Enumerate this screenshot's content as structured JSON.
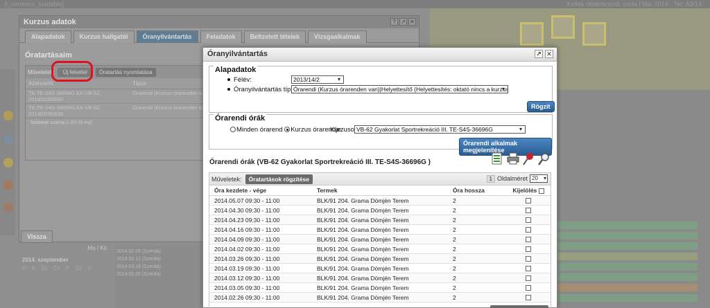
{
  "background": {
    "top_bar_left": "[t_common_loadable]",
    "top_bar_right": "Kellék oktatókoordi. iroda | Ma: 2014 · Ter: A3/14"
  },
  "course_window": {
    "title": "Kurzus adatok",
    "tabs": [
      "Alapadatok",
      "Kurzus hallgatói",
      "Óranyilvántartás",
      "Feladatok",
      "Befizetett tételek",
      "Vizsgaalkalmak"
    ],
    "active_tab": 2,
    "heading": "Óratartásaim",
    "ops_label": "Műveletek:",
    "new_button": "Új felvétel",
    "print_button": "Óratartás nyomtatása",
    "columns": [
      "Azonosító",
      "Típus"
    ],
    "rows": [
      {
        "id": "TK:TE-S4S-36696G;KK:VB-62; 201402050930",
        "type": "Órarendi (Kurzus órarenden van)"
      },
      {
        "id": "TK:TE-S4S-36696G;KK:VB-62; 201402050930",
        "type": "Órarendi (Kurzus órarenden van)"
      }
    ],
    "footer": "Találatok száma:1-2/2 (0 ms)",
    "back_button": "Vissza"
  },
  "calendar": {
    "nav": "Ma / Kö",
    "month": "2014. szeptember",
    "weekdays": "H K Sz Cs P Sz V",
    "list": [
      "2014.02.05 (Szerda)",
      "2014.02.12 (Szerda)",
      "2014.02.19 (Szerda)",
      "2014.02.26 (Szerda)"
    ]
  },
  "modal": {
    "title": "Óranyilvántartás",
    "basic_legend": "Alapadatok",
    "semester_label": "Félév:",
    "semester_value": "2013/14/2",
    "type_label": "Óranyilvántartás típusa:",
    "type_value": "Órarendi (Kurzus órarenden van)|Helyettesítő (Helyettesítés: oktató nincs a kurzushoz",
    "save_button": "Rögzít",
    "schedule_legend": "Órarendi órák",
    "radio_all": "Minden órarend",
    "radio_course": "Kurzus órarendje",
    "course_label": "Kurzusok:",
    "course_value": "VB-62 Gyakorlat Sportrekreáció III. TE-S4S-36696G",
    "show_button": "Órarendi alkalmak megjelenítése",
    "grid_title": "Órarendi órák (VB-62 Gyakorlat Sportrekreáció III. TE-S4S-36696G )",
    "ops_label": "Műveletek:",
    "record_button": "Óratartások rögzítése",
    "page_num": "1",
    "page_size_label": "Oldalméret",
    "page_size": "20",
    "columns": {
      "start_end": "Óra kezdete - vége",
      "room": "Termek",
      "hours": "Óra hossza",
      "select": "Kijelölés"
    },
    "rows": [
      {
        "time": "2014.05.07 09:30 - 11:00",
        "room": "BLK/91 204. Grama Dömjén Terem",
        "hours": "2"
      },
      {
        "time": "2014.04.30 09:30 - 11:00",
        "room": "BLK/91 204. Grama Dömjén Terem",
        "hours": "2"
      },
      {
        "time": "2014.04.23 09:30 - 11:00",
        "room": "BLK/91 204. Grama Dömjén Terem",
        "hours": "2"
      },
      {
        "time": "2014.04.16 09:30 - 11:00",
        "room": "BLK/91 204. Grama Dömjén Terem",
        "hours": "2"
      },
      {
        "time": "2014.04.09 09:30 - 11:00",
        "room": "BLK/91 204. Grama Dömjén Terem",
        "hours": "2"
      },
      {
        "time": "2014.04.02 09:30 - 11:00",
        "room": "BLK/91 204. Grama Dömjén Terem",
        "hours": "2"
      },
      {
        "time": "2014.03.26 09:30 - 11:00",
        "room": "BLK/91 204. Grama Dömjén Terem",
        "hours": "2"
      },
      {
        "time": "2014.03.19 09:30 - 11:00",
        "room": "BLK/91 204. Grama Dömjén Terem",
        "hours": "2"
      },
      {
        "time": "2014.03.12 09:30 - 11:00",
        "room": "BLK/91 204. Grama Dömjén Terem",
        "hours": "2"
      },
      {
        "time": "2014.03.05 09:30 - 11:00",
        "room": "BLK/91 204. Grama Dömjén Terem",
        "hours": "2"
      },
      {
        "time": "2014.02.26 09:30 - 11:00",
        "room": "BLK/91 204. Grama Dömjén Terem",
        "hours": "2"
      }
    ],
    "icons": [
      "excel-export-icon",
      "print-icon",
      "pin-icon",
      "search-icon"
    ]
  }
}
